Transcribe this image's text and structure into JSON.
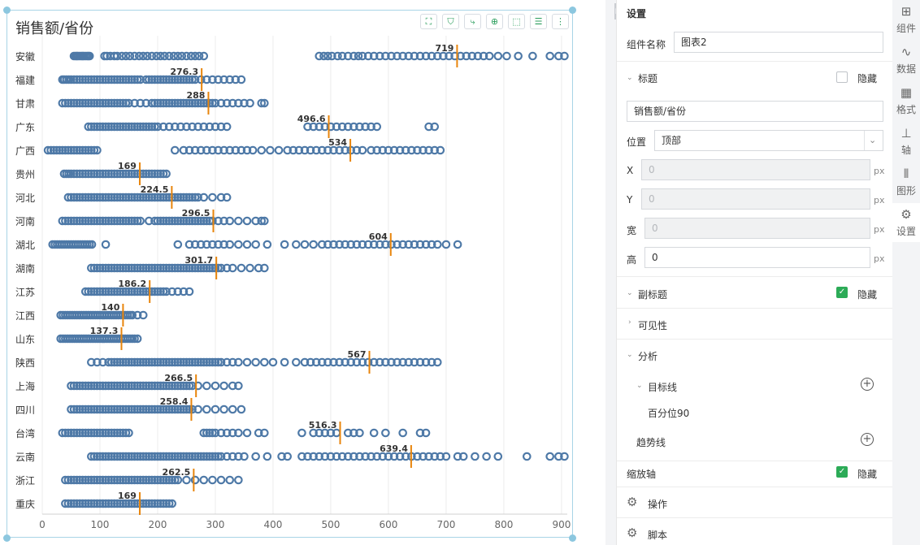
{
  "chart": {
    "title": "销售额/省份",
    "toolbar_icons": [
      "fullscreen-icon",
      "filter-icon",
      "drill-icon",
      "zoom-icon",
      "select-icon",
      "list-icon",
      "more-icon"
    ]
  },
  "chart_data": {
    "type": "scatter",
    "xlim": [
      0,
      910
    ],
    "xticks": [
      "0",
      "100",
      "200",
      "300",
      "400",
      "500",
      "600",
      "700",
      "800",
      "900"
    ],
    "point_color": "#4e79a7",
    "target_line_color": "#e8850c",
    "target_line": "百分位90",
    "categories": [
      "安徽",
      "福建",
      "甘肃",
      "广东",
      "广西",
      "贵州",
      "河北",
      "河南",
      "湖北",
      "湖南",
      "江苏",
      "江西",
      "山东",
      "陕西",
      "上海",
      "四川",
      "台湾",
      "云南",
      "浙江",
      "重庆"
    ],
    "p90": [
      719,
      276.3,
      288,
      496.6,
      534,
      169,
      224.5,
      296.5,
      604,
      301.7,
      186.2,
      140,
      137.3,
      567,
      266.5,
      258.4,
      516.3,
      639.4,
      262.5,
      169
    ],
    "p90_labels": [
      "719",
      "276.3",
      "288",
      "496.6",
      "534",
      "169",
      "224.5",
      "296.5",
      "604",
      "301.7",
      "186.2",
      "140",
      "137.3",
      "567",
      "266.5",
      "258.4",
      "516.3",
      "639.4",
      "262.5",
      "169"
    ],
    "series": [
      {
        "x": [
          55,
          58,
          60,
          62,
          65,
          68,
          70,
          72,
          75,
          78,
          80,
          82,
          108,
          112,
          118,
          125,
          130,
          138,
          145,
          152,
          160,
          168,
          175,
          182,
          190,
          198,
          205,
          212,
          220,
          228,
          235,
          242,
          250,
          258,
          265,
          272,
          280,
          480,
          488,
          495,
          502,
          512,
          520,
          530,
          540,
          548,
          555,
          565,
          575,
          585,
          595,
          605,
          615,
          625,
          635,
          645,
          655,
          665,
          675,
          685,
          695,
          705,
          715,
          725,
          735,
          745,
          755,
          765,
          775,
          790,
          805,
          825,
          850,
          880,
          895,
          905
        ]
      },
      {
        "x": [
          35,
          38,
          42,
          46,
          50,
          55,
          60,
          65,
          70,
          75,
          80,
          85,
          90,
          95,
          100,
          105,
          110,
          115,
          120,
          125,
          130,
          135,
          140,
          145,
          150,
          155,
          160,
          165,
          170,
          180,
          185,
          190,
          195,
          200,
          205,
          210,
          215,
          220,
          225,
          230,
          235,
          240,
          245,
          250,
          255,
          260,
          265,
          275,
          285,
          295,
          305,
          315,
          325,
          335,
          345
        ]
      },
      {
        "x": [
          35,
          40,
          45,
          50,
          55,
          60,
          65,
          70,
          75,
          80,
          85,
          90,
          95,
          100,
          105,
          110,
          115,
          120,
          125,
          130,
          135,
          140,
          145,
          150,
          160,
          170,
          180,
          190,
          195,
          200,
          205,
          210,
          215,
          220,
          225,
          230,
          235,
          240,
          245,
          250,
          255,
          260,
          265,
          270,
          275,
          280,
          285,
          290,
          295,
          300,
          310,
          320,
          330,
          340,
          350,
          360,
          380,
          385
        ]
      },
      {
        "x": [
          80,
          85,
          90,
          95,
          100,
          105,
          110,
          115,
          120,
          125,
          130,
          135,
          140,
          145,
          150,
          155,
          160,
          165,
          170,
          175,
          180,
          185,
          190,
          195,
          200,
          210,
          220,
          230,
          240,
          250,
          260,
          270,
          280,
          290,
          300,
          310,
          320,
          460,
          470,
          480,
          490,
          500,
          510,
          520,
          530,
          540,
          550,
          560,
          570,
          580,
          670,
          680
        ]
      },
      {
        "x": [
          10,
          15,
          20,
          25,
          30,
          35,
          40,
          45,
          50,
          55,
          60,
          65,
          70,
          75,
          80,
          85,
          90,
          95,
          230,
          245,
          255,
          265,
          275,
          285,
          295,
          305,
          315,
          325,
          335,
          345,
          355,
          365,
          380,
          395,
          410,
          425,
          435,
          445,
          455,
          465,
          475,
          485,
          495,
          505,
          515,
          525,
          535,
          545,
          555,
          570,
          580,
          590,
          600,
          610,
          620,
          630,
          640,
          650,
          660,
          670,
          680,
          690
        ]
      },
      {
        "x": [
          38,
          42,
          46,
          50,
          55,
          60,
          65,
          70,
          75,
          80,
          85,
          90,
          95,
          100,
          105,
          110,
          115,
          120,
          125,
          130,
          135,
          140,
          145,
          150,
          155,
          160,
          165,
          170,
          175,
          180,
          185,
          190,
          195,
          200,
          205,
          210,
          215
        ]
      },
      {
        "x": [
          45,
          50,
          55,
          60,
          65,
          70,
          75,
          80,
          85,
          90,
          95,
          100,
          105,
          110,
          115,
          120,
          125,
          130,
          135,
          140,
          145,
          150,
          155,
          160,
          165,
          170,
          175,
          180,
          185,
          190,
          195,
          200,
          205,
          210,
          215,
          220,
          225,
          230,
          235,
          240,
          245,
          250,
          255,
          260,
          265,
          270,
          280,
          295,
          310,
          320
        ]
      },
      {
        "x": [
          35,
          40,
          45,
          50,
          55,
          60,
          65,
          70,
          75,
          80,
          85,
          90,
          95,
          100,
          105,
          110,
          115,
          120,
          125,
          130,
          135,
          140,
          145,
          150,
          155,
          160,
          165,
          170,
          185,
          195,
          200,
          205,
          210,
          215,
          220,
          225,
          230,
          235,
          240,
          245,
          250,
          255,
          260,
          265,
          270,
          275,
          280,
          285,
          290,
          295,
          305,
          315,
          325,
          340,
          355,
          370,
          380,
          385
        ]
      },
      {
        "x": [
          18,
          22,
          26,
          30,
          34,
          38,
          42,
          46,
          50,
          54,
          58,
          62,
          66,
          70,
          74,
          78,
          82,
          86,
          110,
          235,
          255,
          265,
          275,
          285,
          295,
          305,
          315,
          325,
          340,
          355,
          370,
          390,
          420,
          440,
          455,
          470,
          485,
          495,
          505,
          515,
          525,
          535,
          545,
          555,
          565,
          575,
          585,
          595,
          605,
          615,
          625,
          635,
          645,
          655,
          665,
          675,
          685,
          700,
          720
        ]
      },
      {
        "x": [
          85,
          90,
          95,
          100,
          105,
          110,
          115,
          120,
          125,
          130,
          135,
          140,
          145,
          150,
          155,
          160,
          165,
          170,
          175,
          180,
          185,
          190,
          195,
          200,
          205,
          210,
          215,
          220,
          225,
          230,
          235,
          240,
          245,
          250,
          255,
          260,
          265,
          270,
          275,
          280,
          285,
          290,
          295,
          300,
          305,
          310,
          320,
          330,
          345,
          360,
          375,
          385
        ]
      },
      {
        "x": [
          75,
          80,
          85,
          90,
          95,
          100,
          105,
          110,
          115,
          120,
          125,
          130,
          135,
          140,
          145,
          150,
          155,
          160,
          165,
          170,
          175,
          180,
          185,
          190,
          195,
          200,
          205,
          210,
          215,
          225,
          235,
          245,
          255
        ]
      },
      {
        "x": [
          32,
          36,
          40,
          44,
          48,
          52,
          56,
          60,
          64,
          68,
          72,
          76,
          80,
          84,
          88,
          92,
          96,
          100,
          104,
          108,
          112,
          116,
          120,
          124,
          128,
          132,
          136,
          140,
          144,
          148,
          152,
          156,
          165,
          175
        ]
      },
      {
        "x": [
          32,
          36,
          40,
          44,
          48,
          52,
          56,
          60,
          64,
          68,
          72,
          76,
          80,
          84,
          88,
          92,
          96,
          100,
          104,
          108,
          112,
          116,
          120,
          124,
          128,
          132,
          136,
          140,
          144,
          148,
          152,
          156,
          160,
          165
        ]
      },
      {
        "x": [
          85,
          95,
          105,
          115,
          120,
          125,
          130,
          135,
          140,
          145,
          150,
          155,
          160,
          165,
          170,
          175,
          180,
          185,
          190,
          195,
          200,
          205,
          210,
          215,
          220,
          225,
          230,
          235,
          240,
          245,
          250,
          255,
          260,
          265,
          270,
          275,
          280,
          285,
          290,
          295,
          300,
          305,
          310,
          320,
          330,
          340,
          355,
          370,
          385,
          400,
          420,
          440,
          455,
          465,
          475,
          485,
          495,
          505,
          515,
          525,
          535,
          545,
          555,
          565,
          575,
          585,
          595,
          605,
          615,
          625,
          635,
          645,
          655,
          665,
          675,
          685
        ]
      },
      {
        "x": [
          50,
          55,
          60,
          65,
          70,
          75,
          80,
          85,
          90,
          95,
          100,
          105,
          110,
          115,
          120,
          125,
          130,
          135,
          140,
          145,
          150,
          155,
          160,
          165,
          170,
          175,
          180,
          185,
          190,
          195,
          200,
          205,
          210,
          215,
          220,
          225,
          230,
          235,
          240,
          245,
          250,
          255,
          260,
          270,
          285,
          300,
          315,
          330,
          340
        ]
      },
      {
        "x": [
          50,
          55,
          60,
          65,
          70,
          75,
          80,
          85,
          90,
          95,
          100,
          105,
          110,
          115,
          120,
          125,
          130,
          135,
          140,
          145,
          150,
          155,
          160,
          165,
          170,
          175,
          180,
          185,
          190,
          195,
          200,
          205,
          210,
          215,
          220,
          225,
          230,
          235,
          240,
          245,
          250,
          255,
          260,
          270,
          285,
          300,
          315,
          330,
          345
        ]
      },
      {
        "x": [
          35,
          40,
          45,
          50,
          55,
          60,
          65,
          70,
          75,
          80,
          85,
          90,
          95,
          100,
          105,
          110,
          115,
          120,
          125,
          130,
          135,
          140,
          145,
          150,
          280,
          285,
          290,
          295,
          300,
          310,
          320,
          330,
          340,
          355,
          375,
          385,
          450,
          470,
          480,
          490,
          500,
          510,
          530,
          540,
          550,
          575,
          595,
          625,
          655,
          665
        ]
      },
      {
        "x": [
          85,
          90,
          95,
          100,
          105,
          110,
          115,
          120,
          125,
          130,
          135,
          140,
          145,
          150,
          155,
          160,
          165,
          170,
          175,
          180,
          185,
          190,
          195,
          200,
          205,
          210,
          215,
          220,
          225,
          230,
          235,
          240,
          245,
          250,
          255,
          260,
          265,
          270,
          275,
          280,
          285,
          290,
          295,
          300,
          305,
          310,
          320,
          330,
          340,
          350,
          370,
          390,
          415,
          425,
          450,
          460,
          470,
          480,
          490,
          500,
          510,
          520,
          530,
          540,
          550,
          560,
          570,
          580,
          590,
          600,
          610,
          620,
          630,
          640,
          650,
          660,
          670,
          680,
          690,
          700,
          720,
          730,
          750,
          770,
          790,
          840,
          880,
          895,
          905
        ]
      },
      {
        "x": [
          40,
          45,
          50,
          55,
          60,
          65,
          70,
          75,
          80,
          85,
          90,
          95,
          100,
          105,
          110,
          115,
          120,
          125,
          130,
          135,
          140,
          145,
          150,
          155,
          160,
          165,
          170,
          175,
          180,
          185,
          190,
          195,
          200,
          205,
          210,
          215,
          220,
          225,
          230,
          235,
          250,
          265,
          280,
          295,
          310,
          325,
          340
        ]
      },
      {
        "x": [
          40,
          45,
          50,
          55,
          60,
          65,
          70,
          75,
          80,
          85,
          90,
          95,
          100,
          105,
          110,
          115,
          120,
          125,
          130,
          135,
          140,
          145,
          150,
          155,
          160,
          165,
          170,
          175,
          180,
          185,
          190,
          195,
          200,
          205,
          210,
          215,
          220,
          225
        ]
      }
    ]
  },
  "panel": {
    "header": "设置",
    "component_name_label": "组件名称",
    "component_name_value": "图表2",
    "title_section": "标题",
    "hide_label": "隐藏",
    "title_value": "销售额/省份",
    "position_label": "位置",
    "position_value": "顶部",
    "x_label": "X",
    "x_value": "0",
    "y_label": "Y",
    "y_value": "0",
    "width_label": "宽",
    "width_value": "0",
    "height_label": "高",
    "height_value": "0",
    "unit": "px",
    "subtitle_section": "副标题",
    "visibility_section": "可见性",
    "analysis_section": "分析",
    "target_line_label": "目标线",
    "target_line_item": "百分位90",
    "trend_line_label": "趋势线",
    "zoom_axis_label": "缩放轴",
    "operation_label": "操作",
    "script_label": "脚本"
  },
  "tabs": [
    {
      "label": "组件",
      "icon": "component-icon"
    },
    {
      "label": "数据",
      "icon": "data-icon"
    },
    {
      "label": "格式",
      "icon": "format-icon"
    },
    {
      "label": "轴",
      "icon": "axis-icon"
    },
    {
      "label": "图形",
      "icon": "shape-icon"
    },
    {
      "label": "设置",
      "icon": "settings-icon"
    }
  ]
}
